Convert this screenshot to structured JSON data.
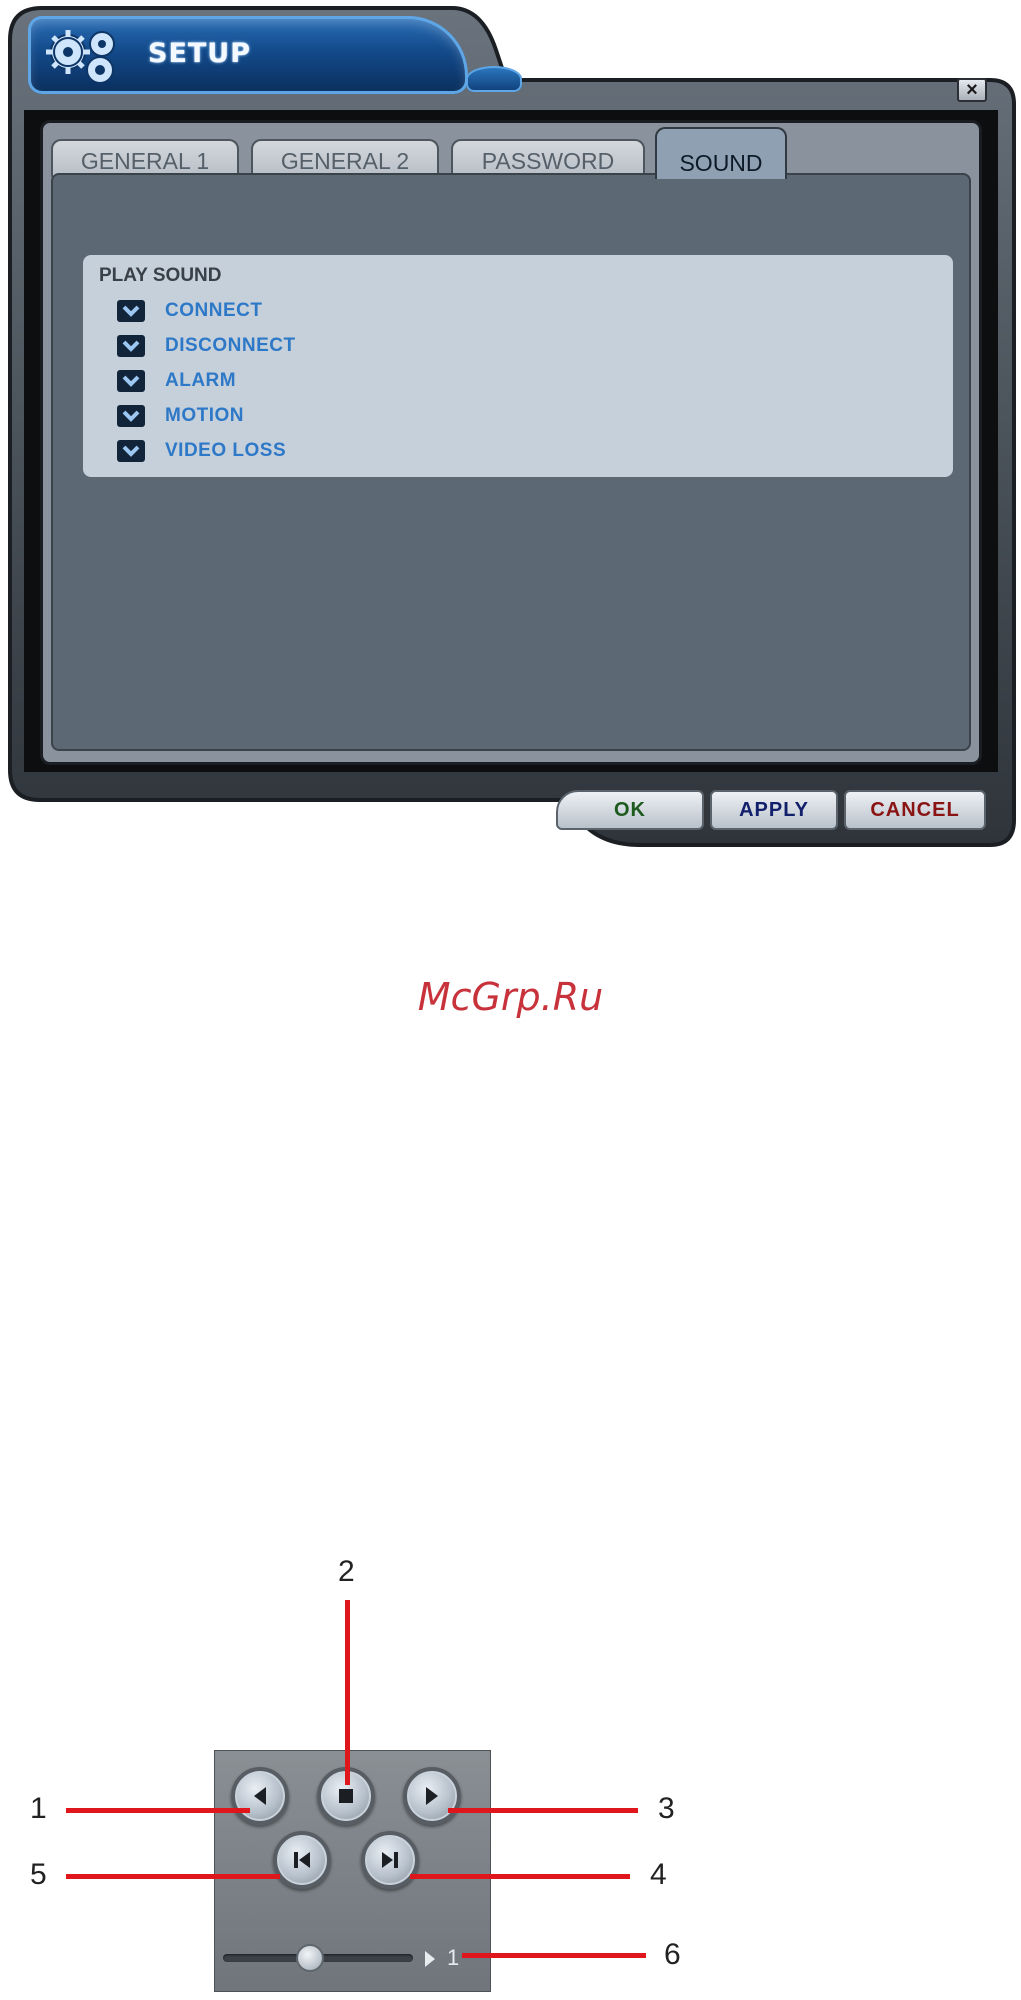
{
  "window": {
    "title": "SETUP",
    "close_label": "×",
    "tabs": [
      {
        "label": "GENERAL 1",
        "active": false
      },
      {
        "label": "GENERAL 2",
        "active": false
      },
      {
        "label": "PASSWORD",
        "active": false
      },
      {
        "label": "SOUND",
        "active": true
      }
    ],
    "play_sound": {
      "title": "PLAY SOUND",
      "options": [
        {
          "label": "CONNECT",
          "checked": true
        },
        {
          "label": "DISCONNECT",
          "checked": true
        },
        {
          "label": "ALARM",
          "checked": true
        },
        {
          "label": "MOTION",
          "checked": true
        },
        {
          "label": "VIDEO LOSS",
          "checked": true
        }
      ]
    },
    "buttons": {
      "ok": "OK",
      "apply": "APPLY",
      "cancel": "CANCEL"
    },
    "colors": {
      "ok": "#1d5a1d",
      "apply": "#12206b",
      "cancel": "#8a1414",
      "option_label": "#2e78c8"
    }
  },
  "watermark": "McGrp.Ru",
  "playback": {
    "speed_value": "1",
    "seek_position_fraction": 0.45,
    "buttons": [
      {
        "icon": "rewind-icon",
        "callout": "1"
      },
      {
        "icon": "stop-icon",
        "callout": "2"
      },
      {
        "icon": "play-icon",
        "callout": "3"
      },
      {
        "icon": "step-forward-icon",
        "callout": "4"
      },
      {
        "icon": "step-backward-icon",
        "callout": "5"
      }
    ],
    "speed_callout": "6",
    "callout_color": "#e0161d"
  }
}
